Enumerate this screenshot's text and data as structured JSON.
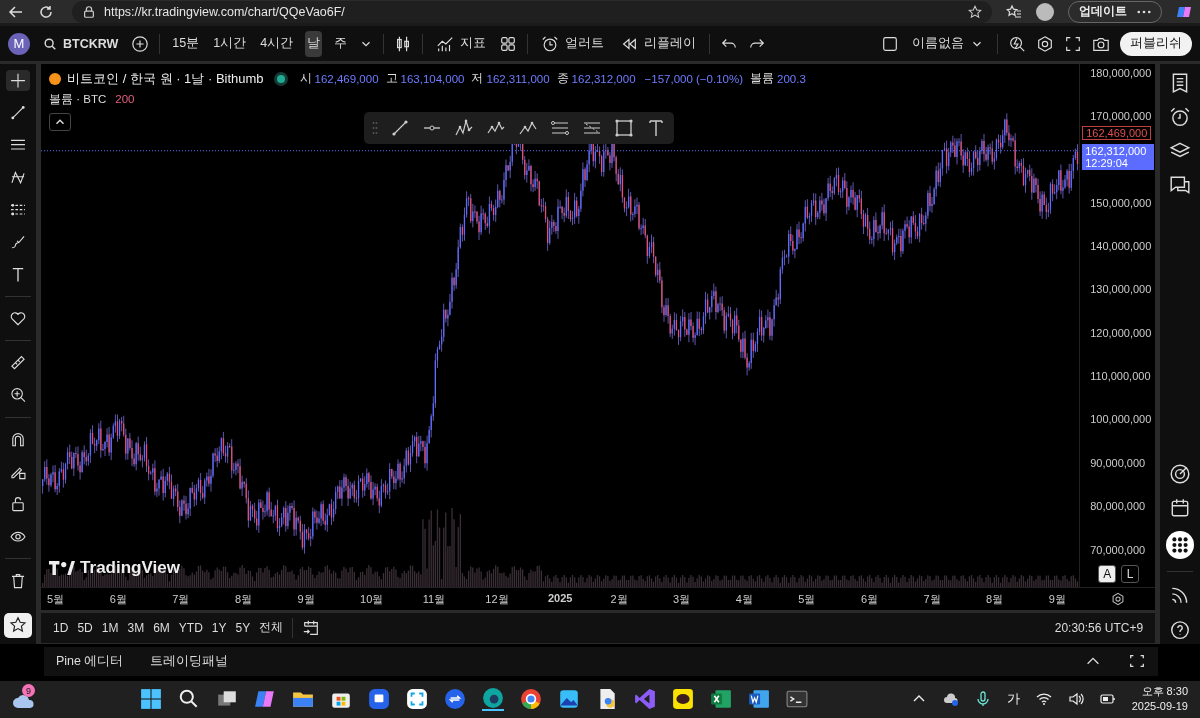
{
  "browser": {
    "url": "https://kr.tradingview.com/chart/QQeVao6F/",
    "update_button": "업데이트"
  },
  "toolbar": {
    "avatar": "M",
    "symbol": "BTCKRW",
    "intervals": [
      {
        "label": "15분",
        "selected": false
      },
      {
        "label": "1시간",
        "selected": false
      },
      {
        "label": "4시간",
        "selected": false
      },
      {
        "label": "날",
        "selected": true
      },
      {
        "label": "주",
        "selected": false
      }
    ],
    "indicators": "지표",
    "alert": "얼러트",
    "replay": "리플레이",
    "layout_name": "이름없음",
    "publish": "퍼블리쉬"
  },
  "legend": {
    "title": "비트코인 / 한국 원 · 1날 · Bithumb",
    "market_open": true,
    "ohlc": [
      {
        "label": "시",
        "value": "162,469,000"
      },
      {
        "label": "고",
        "value": "163,104,000"
      },
      {
        "label": "저",
        "value": "162,311,000"
      },
      {
        "label": "종",
        "value": "162,312,000"
      }
    ],
    "change": "−157,000 (−0.10%)",
    "volume_label": "볼륨",
    "volume_value": "200.3"
  },
  "volume_legend": {
    "label": "볼륨 · BTC",
    "value": "200"
  },
  "watermark": "TradingView",
  "price_axis": {
    "labels": [
      "180,000,000",
      "170,000,000",
      "150,000,000",
      "140,000,000",
      "130,000,000",
      "120,000,000",
      "110,000,000",
      "100,000,000",
      "90,000,000",
      "80,000,000",
      "70,000,000"
    ],
    "open_tag": "162,469,000",
    "price_tag": "162,312,000",
    "countdown": "12:29:04"
  },
  "scale_buttons": [
    {
      "label": "A",
      "selected": true
    },
    {
      "label": "L",
      "selected": false
    }
  ],
  "time_axis": [
    "5월",
    "6월",
    "7월",
    "8월",
    "9월",
    "10월",
    "11월",
    "12월",
    "2025",
    "2월",
    "3월",
    "4월",
    "5월",
    "6월",
    "7월",
    "8월",
    "9월"
  ],
  "ranges": [
    "1D",
    "5D",
    "1M",
    "3M",
    "6M",
    "YTD",
    "1Y",
    "5Y",
    "전체"
  ],
  "clock": "20:30:56 UTC+9",
  "bottom_tabs": [
    "Pine 에디터",
    "트레이딩패널"
  ],
  "taskbar": {
    "weather_badge": "9",
    "ime": "가",
    "time": "오후 8:30",
    "date": "2025-09-19"
  }
}
